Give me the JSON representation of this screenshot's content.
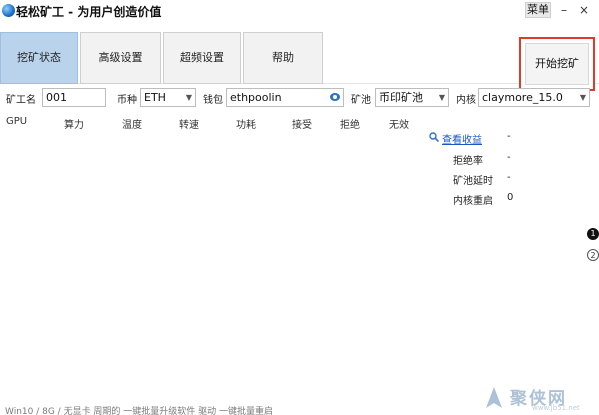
{
  "window": {
    "title": "轻松矿工 - 为用户创造价值",
    "menu_label": "菜单",
    "minimize_label": "–",
    "close_label": "×"
  },
  "tabs": [
    {
      "label": "挖矿状态",
      "active": true
    },
    {
      "label": "高级设置",
      "active": false
    },
    {
      "label": "超频设置",
      "active": false
    },
    {
      "label": "帮助",
      "active": false
    }
  ],
  "start_button_label": "开始挖矿",
  "form": {
    "miner_name_label": "矿工名",
    "miner_name_value": "001",
    "coin_label": "币种",
    "coin_value": "ETH",
    "wallet_label": "钱包",
    "wallet_value": "ethpoolin",
    "pool_label": "矿池",
    "pool_value": "币印矿池",
    "kernel_label": "内核",
    "kernel_value": "claymore_15.0"
  },
  "gpu_columns": [
    "GPU",
    "算力",
    "温度",
    "转速",
    "功耗",
    "接受",
    "拒绝",
    "无效"
  ],
  "stats": {
    "view_earnings_label": "查看收益",
    "view_earnings_value": "-",
    "reject_rate_label": "拒绝率",
    "reject_rate_value": "-",
    "pool_latency_label": "矿池延时",
    "pool_latency_value": "-",
    "kernel_restart_label": "内核重启",
    "kernel_restart_value": "0"
  },
  "pages": [
    "1",
    "2"
  ],
  "status_text": "Win10 / 8G / 无显卡   周期的   一键批量升级软件   驱动   一键批量重启",
  "watermark": {
    "text": "聚侠网",
    "sub": "www.jb51.net"
  },
  "colors": {
    "active_tab": "#b9d3ec",
    "start_highlight": "#e03a2a",
    "link": "#1a56c4"
  }
}
